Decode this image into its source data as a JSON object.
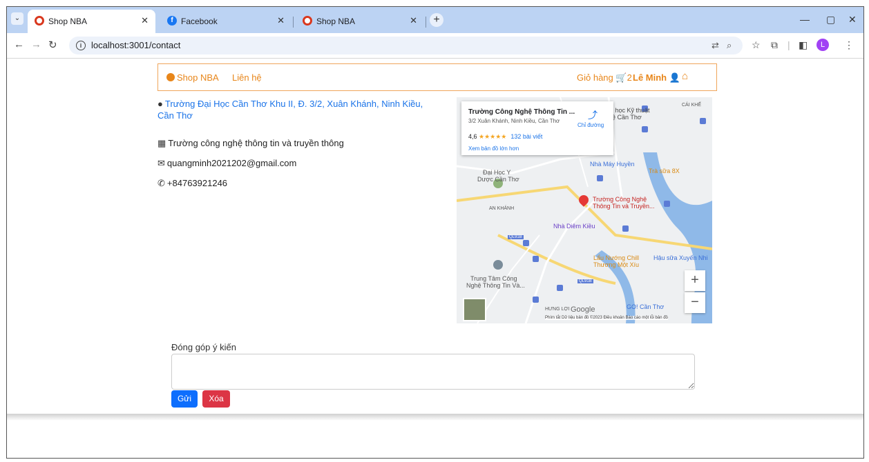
{
  "browser": {
    "tabs": [
      {
        "title": "Shop NBA",
        "active": true
      },
      {
        "title": "Facebook",
        "active": false
      },
      {
        "title": "Shop NBA",
        "active": false
      }
    ],
    "url": "localhost:3001/contact",
    "profile_initial": "L"
  },
  "navbar": {
    "brand": "Shop NBA",
    "contact_link": "Liên hệ",
    "cart_label": "Giỏ hàng",
    "cart_count": "2",
    "user_name": "Lê Minh"
  },
  "contact": {
    "address": "Trường Đại Học Cần Thơ Khu II, Đ. 3/2, Xuân Khánh, Ninh Kiều, Cần Thơ",
    "school": "Trường công nghệ thông tin và truyền thông",
    "email": "quangminh2021202@gmail.com",
    "phone": "+84763921246"
  },
  "map": {
    "place_title": "Trường Công Nghệ Thông Tin ...",
    "place_address": "3/2 Xuân Khánh, Ninh Kiều, Cần Thơ",
    "rating": "4,6",
    "stars": "★★★★★",
    "reviews": "132 bài viết",
    "view_larger": "Xem bản đồ lớn hơn",
    "directions": "Chỉ đường",
    "labels": {
      "pin_label_1": "Trường Công Nghệ",
      "pin_label_2": "Thông Tin và Truyền...",
      "dai_hoc_y_1": "Đại Học Y",
      "dai_hoc_y_2": "Dược Cần Thơ",
      "an_khanh": "AN KHÁNH",
      "nha_diem_kieu": "Nhà Diêm Kiều",
      "nha_may_huyen": "Nhà Máy Huyền",
      "tra_sua": "Trà sữa 8X",
      "lau_nuong_1": "Lẩu Nướng Chill",
      "lau_nuong_2": "Thương Một Xíu",
      "trung_tam_1": "Trung Tâm Công",
      "trung_tam_2": "Nghệ Thông Tin Và...",
      "hung_loi": "HƯNG LỢI",
      "go_can_tho": "GO! Cần Thơ",
      "ql91b": "QL91B",
      "dh_ky_thuat": "i học Kỹ thuật",
      "can_tho": "ệ Cần Thơ",
      "cai_khe": "CÁI KHẾ",
      "hau_sua": "Hậu sữa Xuyến Nhi"
    },
    "google": "Google",
    "footer": "Phím tắt   Dữ liệu bản đồ ©2023   Điều khoản   Báo cáo một lỗi bản đồ"
  },
  "feedback": {
    "label": "Đóng góp ý kiến",
    "textarea_value": "",
    "send_label": "Gửi",
    "delete_label": "Xóa"
  }
}
